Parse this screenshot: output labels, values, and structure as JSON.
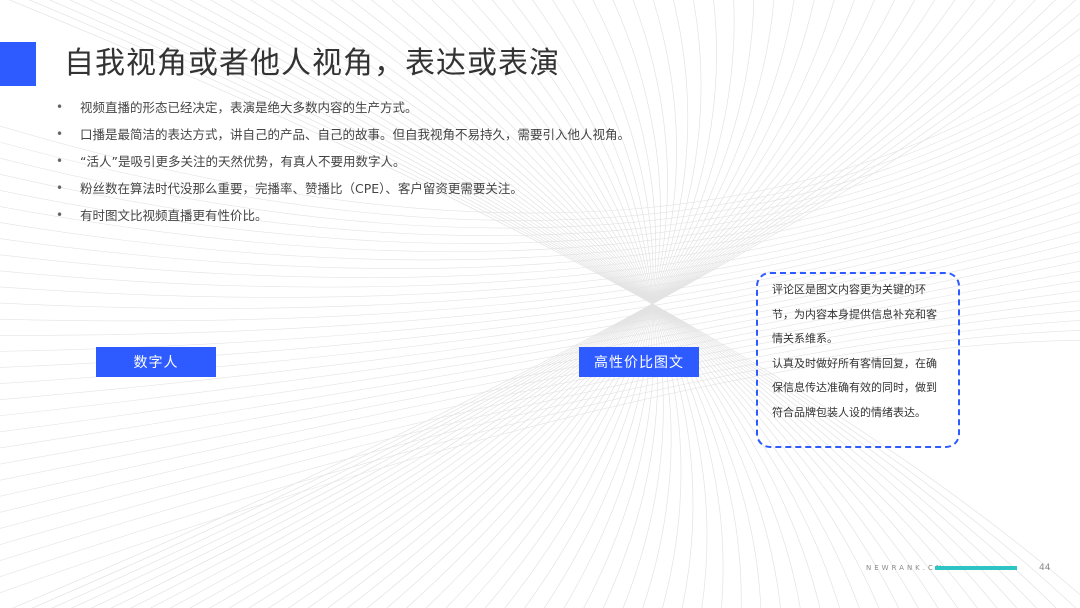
{
  "slide": {
    "title": "自我视角或者他人视角，表达或表演",
    "bullets": [
      "视频直播的形态已经决定，表演是绝大多数内容的生产方式。",
      "口播是最简洁的表达方式，讲自己的产品、自己的故事。但自我视角不易持久，需要引入他人视角。",
      "“活人”是吸引更多关注的天然优势，有真人不要用数字人。",
      "粉丝数在算法时代没那么重要，完播率、赞播比（CPE）、客户留资更需要关注。",
      "有时图文比视频直播更有性价比。"
    ],
    "bullet_marker": "•",
    "buttons": {
      "digital_human": "数字人",
      "value_image_text": "高性价比图文"
    },
    "note_lines": [
      "评论区是图文内容更为关键的环",
      "节，为内容本身提供信息补充和客",
      "情关系维系。",
      "认真及时做好所有客情回复，在确",
      "保信息传达准确有效的同时，做到",
      "符合品牌包装人设的情绪表达。"
    ]
  },
  "footer": {
    "brand": "NEWRANK.CN",
    "page_number": "44"
  },
  "colors": {
    "accent": "#2e5bff",
    "footer_bar": "#2ec4c4",
    "background_lines": "#e3e3e3"
  }
}
